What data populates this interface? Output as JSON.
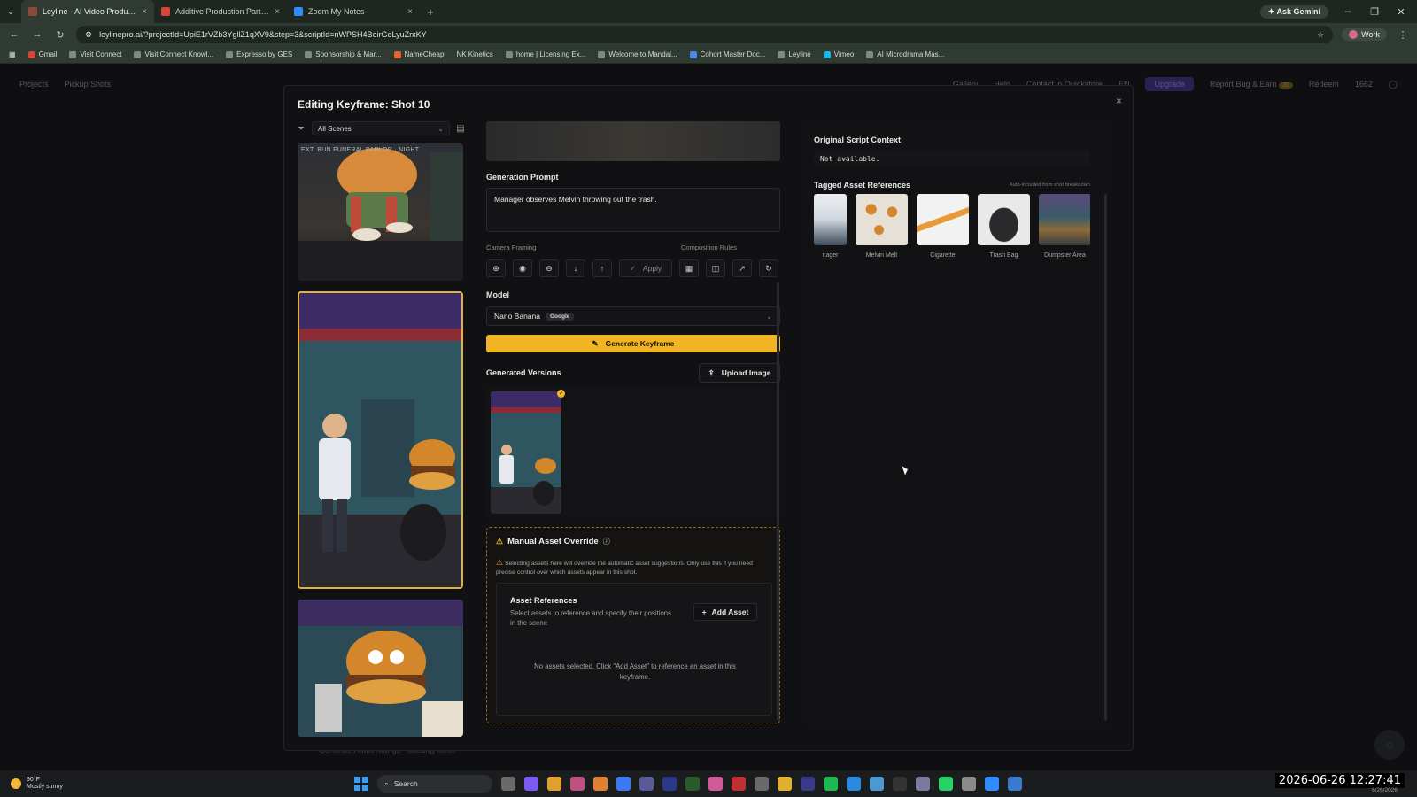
{
  "browser": {
    "tabs": [
      {
        "label": "Leyline - AI Video Production P",
        "active": true,
        "color": "#8a4a3a"
      },
      {
        "label": "Additive Production Partner - ",
        "active": false,
        "color": "#d44638"
      },
      {
        "label": "Zoom My Notes",
        "active": false,
        "color": "#2d8cff"
      }
    ],
    "new_tab": "+",
    "ask_gemini": "Ask Gemini",
    "url": "leylinepro.ai/?projectId=UpiE1rVZb3YgllZ1qXV9&step=3&scriptId=nWPSH4BeirGeLyuZrxKY",
    "profile": "Work",
    "bookmarks": [
      "Gmail",
      "Visit Connect",
      "Visit Connect Knowl...",
      "Expresso by GES",
      "Sponsorship & Mar...",
      "NameCheap",
      "NK Kinetics",
      "home | Licensing Ex...",
      "Welcome to Mandal...",
      "Cohort Master Doc...",
      "Leyline",
      "Vimeo",
      "AI Microdrama Mas..."
    ]
  },
  "app_nav": {
    "left": [
      "Projects",
      "Pickup Shots"
    ],
    "right": [
      "Gallery",
      "Help",
      "Contact in Quickstore",
      "EN",
      "Upgrade",
      "Report Bug & Earn",
      "Redeem",
      "1662"
    ],
    "report_badge": "20",
    "footer": "Generate Audio Mangs · Casting Soon"
  },
  "modal": {
    "title": "Editing Keyframe: Shot 10",
    "close": "×",
    "scene_filter": "All Scenes",
    "thumb1_label": "EXT. BUN FUNERAL PARLOR · NIGHT",
    "generation_prompt_label": "Generation Prompt",
    "generation_prompt": "Manager observes Melvin throwing out the trash.",
    "camera_framing_label": "Camera Framing",
    "composition_rules_label": "Composition Rules",
    "apply_label": "Apply",
    "model_label": "Model",
    "model_name": "Nano Banana",
    "model_provider": "Google",
    "generate_label": "Generate Keyframe",
    "generated_versions_label": "Generated Versions",
    "upload_label": "Upload Image",
    "override_title": "Manual Asset Override",
    "override_desc": "Selecting assets here will override the automatic asset suggestions. Only use this if you need precise control over which assets appear in this shot.",
    "asset_refs_title": "Asset References",
    "asset_refs_desc": "Select assets to reference and specify their positions in the scene",
    "add_asset_label": "Add Asset",
    "no_assets_text": "No assets selected. Click \"Add Asset\" to reference an asset in this keyframe.",
    "script_context_label": "Original Script Context",
    "script_context_value": "Not available.",
    "tagged_label": "Tagged Asset References",
    "auto_included_note": "Auto-included from shot breakdown",
    "tagged_assets": [
      {
        "name": "nager",
        "color": "#3e4b5a"
      },
      {
        "name": "Melvin Melt",
        "color": "#d8d2c6"
      },
      {
        "name": "Cigarette",
        "color": "#f2f2f2"
      },
      {
        "name": "Trash Bag",
        "color": "#e9e9e9"
      },
      {
        "name": "Dumpster Area",
        "color": "#4a4f6a"
      }
    ]
  },
  "taskbar": {
    "temp": "90°F",
    "weather": "Mostly sunny",
    "search": "Search",
    "clock": "2026-06-26  12:27:41",
    "date": "6/26/2026"
  }
}
